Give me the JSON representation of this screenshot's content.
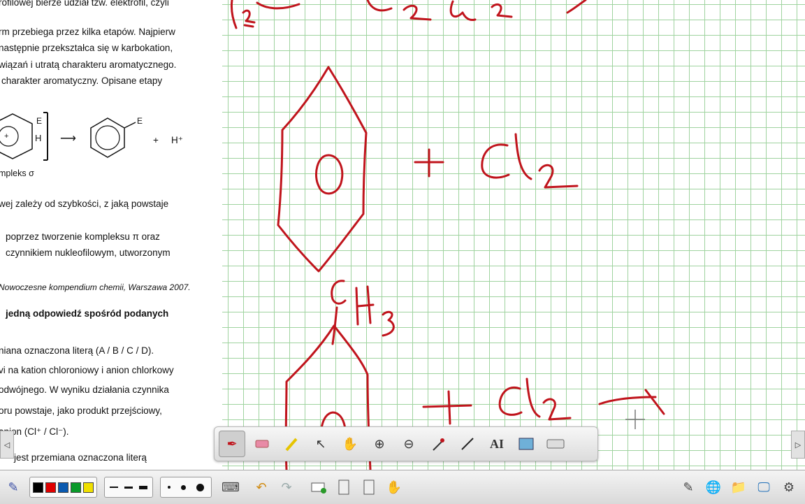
{
  "document": {
    "lines": [
      "rofilowej bierze udział tzw. elektrofil, czyli",
      "rm przebiega przez kilka etapów. Najpierw",
      "następnie przekształca się w karbokation,",
      "wiązań i utratą charakteru aromatycznego.",
      "charakter aromatyczny. Opisane etapy",
      "mpleks σ",
      "wej zależy od szybkości, z jaką powstaje",
      "poprzez tworzenie kompleksu π oraz",
      "czynnikiem nukleofilowym, utworzonym",
      "Nowoczesne kompendium chemii, Warszawa 2007.",
      "jedną odpowiedź spośród podanych",
      "niana oznaczona literą (A / B / C / D).",
      "vi na kation chloroniowy i anion chlorkowy",
      "odwójnego. W wyniku działania czynnika",
      "oru powstaje, jako produkt przejściowy,",
      "anion (Cl⁺ / Cl⁻).",
      "jest przemiana oznaczona literą"
    ],
    "scheme": {
      "e_label_top": "E",
      "h_label": "H",
      "arrow": "⟶",
      "e_label_product": "E",
      "plus": "+",
      "proton": "H⁺"
    }
  },
  "colors": {
    "ink": "#c0141c",
    "grid": "#9fd39f"
  },
  "floating_toolbar": {
    "tools": [
      {
        "name": "pen-tool",
        "icon": "pen-icon"
      },
      {
        "name": "eraser-tool",
        "icon": "eraser-icon"
      },
      {
        "name": "highlighter-tool",
        "icon": "highlighter-icon"
      },
      {
        "name": "select-tool",
        "icon": "pointer-icon"
      },
      {
        "name": "hand-tool",
        "icon": "hand-icon"
      },
      {
        "name": "zoom-in-tool",
        "icon": "zoom-in-icon"
      },
      {
        "name": "zoom-out-tool",
        "icon": "zoom-out-icon"
      },
      {
        "name": "pipette-tool",
        "icon": "pipette-icon"
      },
      {
        "name": "line-tool",
        "icon": "line-icon"
      },
      {
        "name": "text-tool",
        "icon": "text-icon",
        "label": "AI"
      },
      {
        "name": "screen-capture-tool",
        "icon": "capture-icon"
      },
      {
        "name": "keyboard-tool",
        "icon": "keyboard-icon"
      }
    ]
  },
  "bottom_bar": {
    "pen_colors": [
      "#000000",
      "#e00000",
      "#0a5ab0",
      "#0a9a2a",
      "#f0e000"
    ],
    "side_tab_left": "◁",
    "side_tab_right": "▷"
  }
}
